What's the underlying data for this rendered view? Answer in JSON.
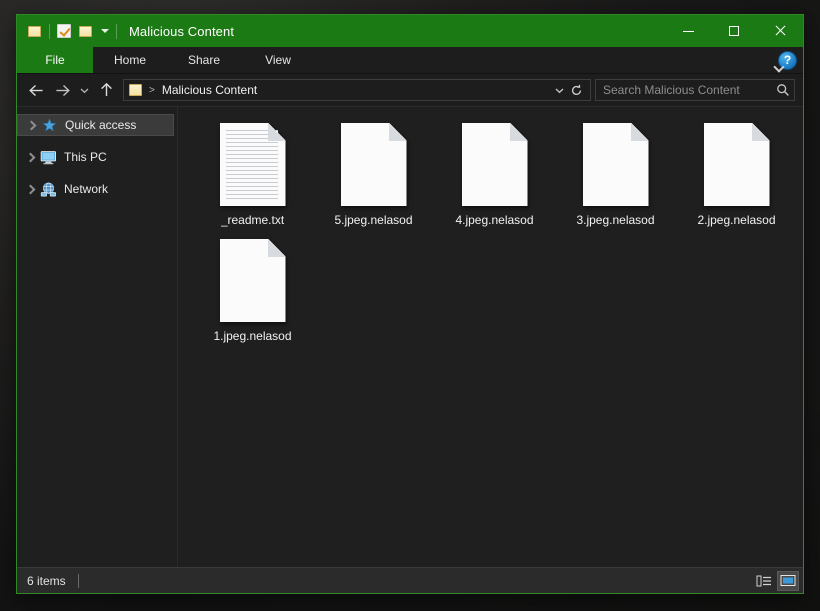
{
  "window": {
    "title": "Malicious Content",
    "quick_access_toolbar": [
      {
        "name": "properties-folder-icon",
        "icon": "folder-icon"
      },
      {
        "name": "properties-checkbox-icon",
        "icon": "checkbox-icon"
      },
      {
        "name": "new-folder-icon",
        "icon": "folder-icon"
      },
      {
        "name": "customize-qat-caret",
        "icon": "caret-down-icon"
      }
    ],
    "controls": {
      "minimize": "Minimize",
      "maximize": "Maximize",
      "close": "Close"
    },
    "accent_color": "#1b7a14",
    "content_bg": "#1f1f1f"
  },
  "ribbon": {
    "tabs": [
      {
        "label": "File",
        "active": true
      },
      {
        "label": "Home",
        "active": false
      },
      {
        "label": "Share",
        "active": false
      },
      {
        "label": "View",
        "active": false
      }
    ],
    "expand_label": "Expand the Ribbon",
    "help_label": "?"
  },
  "navigation": {
    "back_label": "Back",
    "forward_label": "Forward",
    "recent_label": "Recent locations",
    "up_label": "Up",
    "breadcrumb": {
      "separator": ">",
      "path": "Malicious Content"
    },
    "dropdown_label": "Previous locations",
    "refresh_label": "Refresh"
  },
  "search": {
    "placeholder": "Search Malicious Content",
    "value": "",
    "icon": "search-icon"
  },
  "sidebar": {
    "items": [
      {
        "label": "Quick access",
        "icon": "star-pin-icon",
        "selected": true
      },
      {
        "label": "This PC",
        "icon": "monitor-icon",
        "selected": false
      },
      {
        "label": "Network",
        "icon": "network-icon",
        "selected": false
      }
    ]
  },
  "files": [
    {
      "name": "_readme.txt",
      "icon": "text-document-icon"
    },
    {
      "name": "5.jpeg.nelasod",
      "icon": "blank-document-icon"
    },
    {
      "name": "4.jpeg.nelasod",
      "icon": "blank-document-icon"
    },
    {
      "name": "3.jpeg.nelasod",
      "icon": "blank-document-icon"
    },
    {
      "name": "2.jpeg.nelasod",
      "icon": "blank-document-icon"
    },
    {
      "name": "1.jpeg.nelasod",
      "icon": "blank-document-icon"
    }
  ],
  "status": {
    "item_count": "6 items",
    "views": [
      {
        "name": "details-view",
        "active": false
      },
      {
        "name": "large-icons-view",
        "active": true
      }
    ]
  }
}
